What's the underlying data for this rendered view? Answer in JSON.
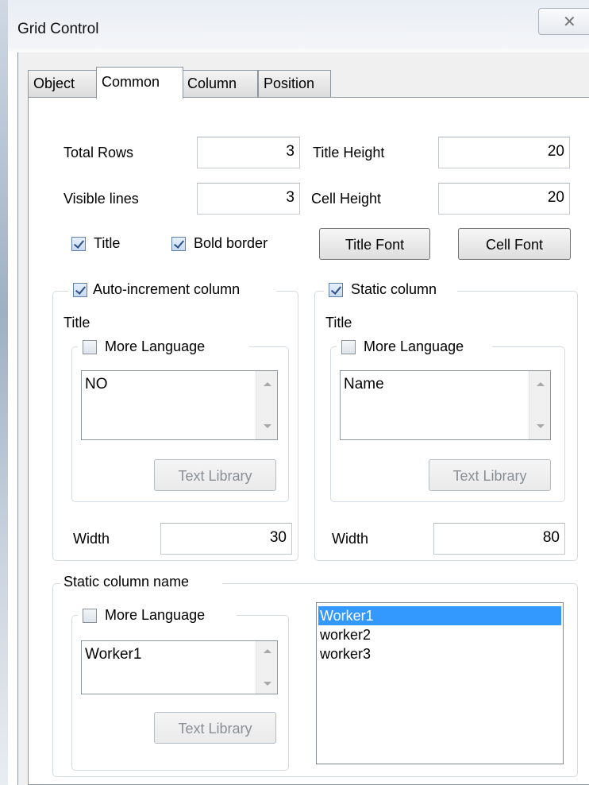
{
  "window": {
    "title": "Grid Control",
    "close_glyph": "✕"
  },
  "tabs": [
    "Object",
    "Common",
    "Column",
    "Position"
  ],
  "active_tab": "Common",
  "fields": {
    "total_rows_label": "Total Rows",
    "total_rows_value": "3",
    "title_height_label": "Title Height",
    "title_height_value": "20",
    "visible_lines_label": "Visible lines",
    "visible_lines_value": "3",
    "cell_height_label": "Cell Height",
    "cell_height_value": "20"
  },
  "options": {
    "title_label": "Title",
    "title_checked": true,
    "bold_border_label": "Bold border",
    "bold_border_checked": true,
    "title_font_button": "Title Font",
    "cell_font_button": "Cell Font"
  },
  "auto_increment": {
    "label": "Auto-increment column",
    "checked": true,
    "title_label": "Title",
    "more_language_label": "More Language",
    "more_language_checked": false,
    "text_value": "NO",
    "text_library_button": "Text Library",
    "width_label": "Width",
    "width_value": "30"
  },
  "static_column": {
    "label": "Static column",
    "checked": true,
    "title_label": "Title",
    "more_language_label": "More Language",
    "more_language_checked": false,
    "text_value": "Name",
    "text_library_button": "Text Library",
    "width_label": "Width",
    "width_value": "80"
  },
  "static_column_name": {
    "legend": "Static column name",
    "more_language_label": "More Language",
    "more_language_checked": false,
    "text_value": "Worker1",
    "text_library_button": "Text Library",
    "list_items": [
      "Worker1",
      "worker2",
      "worker3"
    ],
    "selected_item": "Worker1"
  },
  "colors": {
    "selection": "#3399ff",
    "panel_bg": "#ffffff",
    "dialog_bg": "#f0f0f0"
  }
}
